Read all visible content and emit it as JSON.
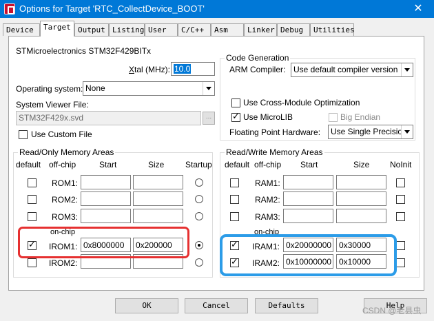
{
  "window": {
    "title": "Options for Target 'RTC_CollectDevice_BOOT'",
    "close_glyph": "✕"
  },
  "tabs": [
    {
      "label": "Device"
    },
    {
      "label": "Target"
    },
    {
      "label": "Output"
    },
    {
      "label": "Listing"
    },
    {
      "label": "User"
    },
    {
      "label": "C/C++"
    },
    {
      "label": "Asm"
    },
    {
      "label": "Linker"
    },
    {
      "label": "Debug"
    },
    {
      "label": "Utilities"
    }
  ],
  "device_name": "STMicroelectronics STM32F429BITx",
  "xtal": {
    "label_prefix": "",
    "label_ul": "X",
    "label_rest": "tal (MHz):",
    "value": "10.0"
  },
  "os": {
    "label": "Operating system:",
    "value": "None"
  },
  "svf": {
    "label": "System Viewer File:",
    "value": "STM32F429x.svd",
    "browse": "..."
  },
  "custom_file": {
    "label": "Use Custom File",
    "checked": false
  },
  "codegen": {
    "title": "Code Generation",
    "compiler_label": "ARM Compiler:",
    "compiler_value": "Use default compiler version",
    "cross_module": "Use Cross-Module Optimization",
    "microlib": "Use MicroLIB",
    "big_endian": "Big Endian",
    "fph_label": "Floating Point Hardware:",
    "fph_value": "Use Single Precision"
  },
  "ro": {
    "title": "Read/Only Memory Areas",
    "headers": {
      "default": "default",
      "offchip": "off-chip",
      "start": "Start",
      "size": "Size",
      "startup": "Startup"
    },
    "onchip_label": "on-chip",
    "rows": [
      {
        "name": "ROM1:",
        "start": "",
        "size": ""
      },
      {
        "name": "ROM2:",
        "start": "",
        "size": ""
      },
      {
        "name": "ROM3:",
        "start": "",
        "size": ""
      },
      {
        "name": "IROM1:",
        "start": "0x8000000",
        "size": "0x200000"
      },
      {
        "name": "IROM2:",
        "start": "",
        "size": ""
      }
    ]
  },
  "rw": {
    "title": "Read/Write Memory Areas",
    "headers": {
      "default": "default",
      "offchip": "off-chip",
      "start": "Start",
      "size": "Size",
      "noinit": "NoInit"
    },
    "onchip_label": "on-chip",
    "rows": [
      {
        "name": "RAM1:",
        "start": "",
        "size": ""
      },
      {
        "name": "RAM2:",
        "start": "",
        "size": ""
      },
      {
        "name": "RAM3:",
        "start": "",
        "size": ""
      },
      {
        "name": "IRAM1:",
        "start": "0x20000000",
        "size": "0x30000"
      },
      {
        "name": "IRAM2:",
        "start": "0x10000000",
        "size": "0x10000"
      }
    ]
  },
  "buttons": {
    "ok": "OK",
    "cancel": "Cancel",
    "defaults": "Defaults",
    "help": "Help"
  },
  "watermark": "CSDN @老县虫",
  "colors": {
    "titlebar": "#0078d7",
    "highlight_red": "#e63030",
    "highlight_blue": "#2c9ce8"
  }
}
